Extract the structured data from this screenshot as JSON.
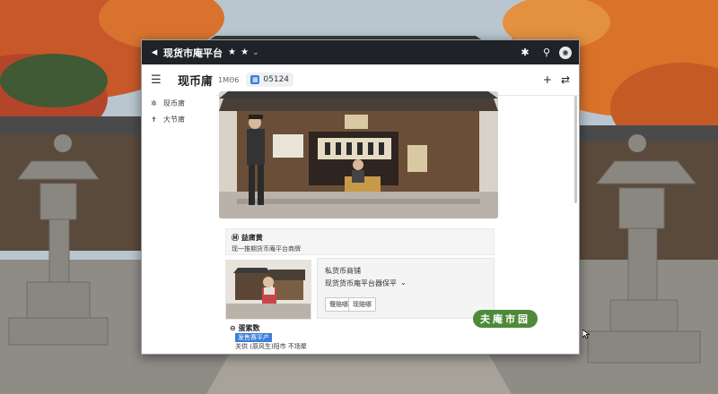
{
  "app_title": "现货市庵平台",
  "rating_stars": "★ ★",
  "header": {
    "title": "现币庯",
    "subtitle": "1ΜΘ6",
    "chip_text": "05124"
  },
  "sidebar": {
    "items": [
      {
        "label": "现币庯",
        "icon": "sparkle-icon"
      },
      {
        "label": "大节庯",
        "icon": "pin-icon"
      }
    ]
  },
  "info_card": {
    "title": "Ⓜ 益庯黄",
    "description": "现一推期货币庵平台商牌"
  },
  "detail_card": {
    "label": "私货币商铺",
    "dropdown_text": "现货货币庵平台器保平",
    "buttons": [
      "偃赔哪",
      "现赔哪"
    ]
  },
  "featured": {
    "title": "⊖ 蛋紫数",
    "tag": "发售赛平产",
    "description": "关供 (原风生)阳市 不场聚"
  },
  "badge_text": "夫庵市园",
  "colors": {
    "topbar": "#1f2327",
    "accent_blue": "#3c7dd8",
    "badge_green": "#4e8a3a"
  }
}
